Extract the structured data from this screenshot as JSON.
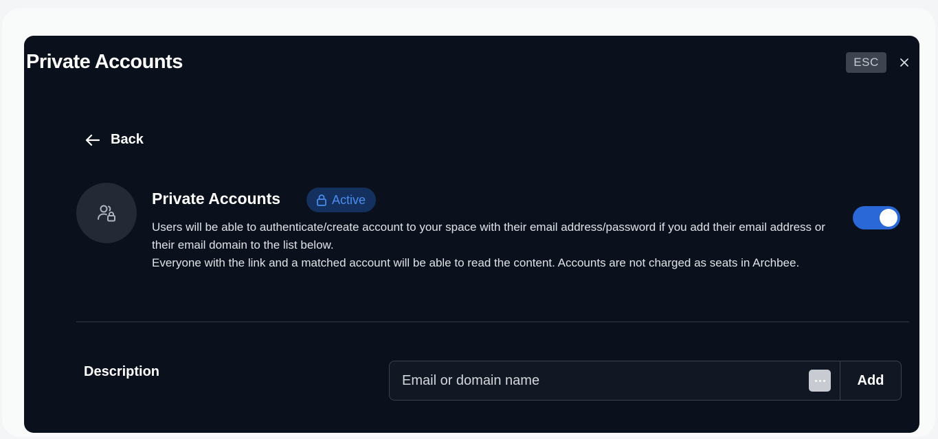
{
  "modal": {
    "title": "Private Accounts",
    "esc_label": "ESC",
    "close_icon": "close-icon"
  },
  "back": {
    "icon": "arrow-left-icon",
    "label": "Back"
  },
  "private_accounts": {
    "avatar_icon": "user-lock-icon",
    "title": "Private Accounts",
    "status_badge": {
      "icon": "lock-icon",
      "label": "Active",
      "color": "#4c8df0"
    },
    "description_line1": "Users will be able to authenticate/create account to your space with their email address/password if you add their email address or their email domain to the list below.",
    "description_line2": "Everyone with the link and a matched account will be able to read the content. Accounts are not charged as seats in Archbee.",
    "toggle_enabled": true,
    "toggle_color": "#2b68d7"
  },
  "description_field": {
    "label": "Description",
    "input_value": "",
    "input_placeholder": "Email or domain name",
    "dots_icon": "more-dots-icon",
    "add_label": "Add"
  }
}
